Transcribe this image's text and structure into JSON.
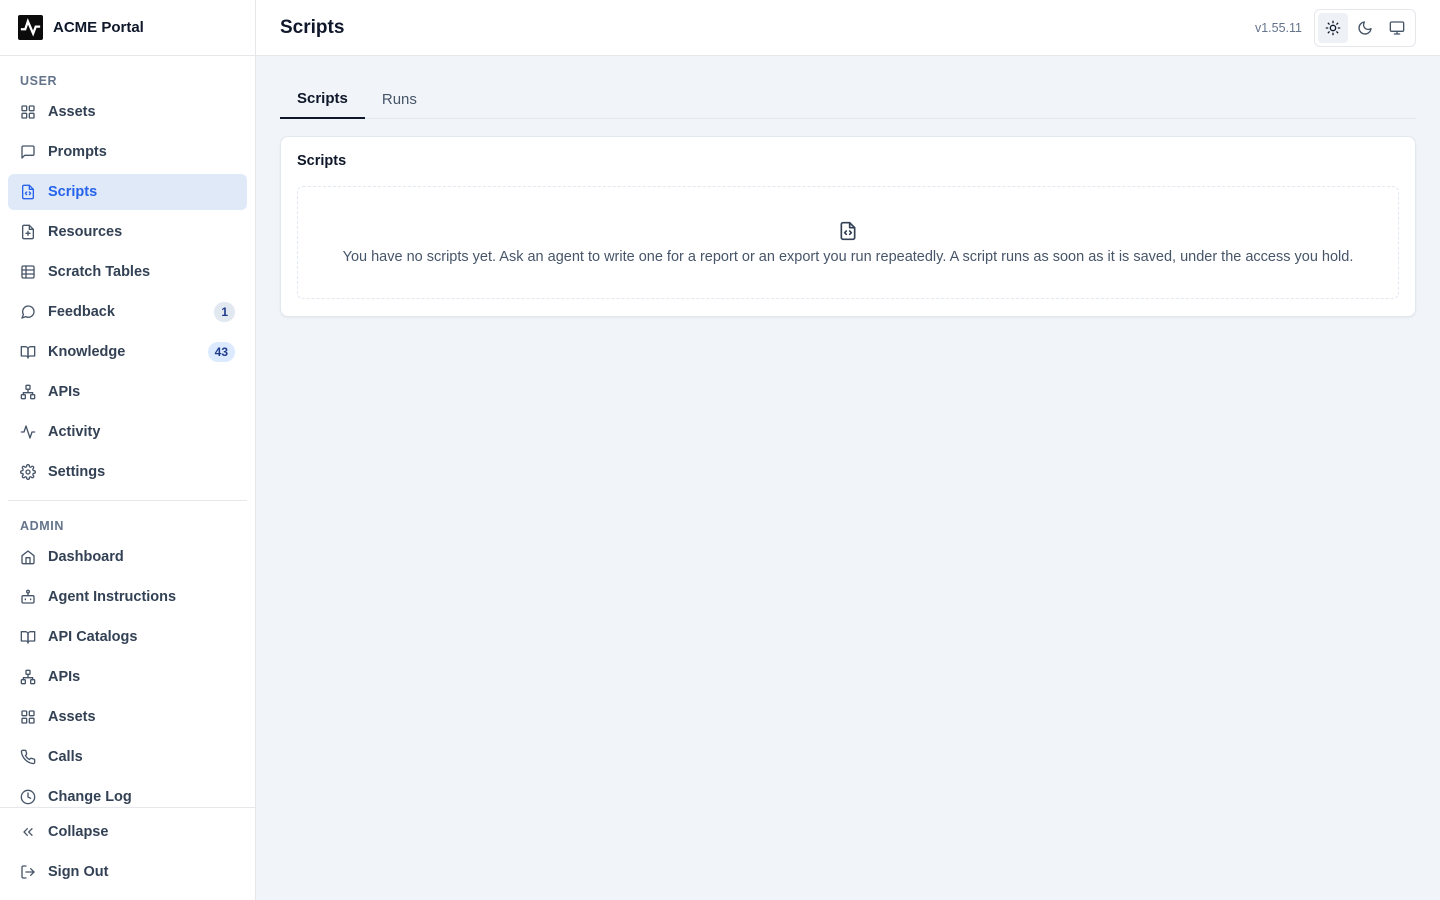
{
  "brand": {
    "name": "ACME Portal"
  },
  "sidebar": {
    "user_section_label": "USER",
    "user_items": [
      {
        "label": "Assets",
        "icon": "grid-icon"
      },
      {
        "label": "Prompts",
        "icon": "message-square-icon"
      },
      {
        "label": "Scripts",
        "icon": "file-code-icon",
        "active": true
      },
      {
        "label": "Resources",
        "icon": "file-plus-icon"
      },
      {
        "label": "Scratch Tables",
        "icon": "table-icon"
      },
      {
        "label": "Feedback",
        "icon": "message-circle-icon",
        "badge": "1"
      },
      {
        "label": "Knowledge",
        "icon": "book-open-icon",
        "badge": "43"
      },
      {
        "label": "APIs",
        "icon": "network-icon"
      },
      {
        "label": "Activity",
        "icon": "activity-icon"
      },
      {
        "label": "Settings",
        "icon": "gear-icon"
      }
    ],
    "admin_section_label": "ADMIN",
    "admin_items": [
      {
        "label": "Dashboard",
        "icon": "home-icon"
      },
      {
        "label": "Agent Instructions",
        "icon": "bot-icon"
      },
      {
        "label": "API Catalogs",
        "icon": "book-open-icon"
      },
      {
        "label": "APIs",
        "icon": "network-icon"
      },
      {
        "label": "Assets",
        "icon": "grid-icon"
      },
      {
        "label": "Calls",
        "icon": "phone-icon"
      },
      {
        "label": "Change Log",
        "icon": "clock-icon"
      }
    ],
    "footer": {
      "collapse_label": "Collapse",
      "signout_label": "Sign Out"
    }
  },
  "header": {
    "title": "Scripts",
    "version": "v1.55.11",
    "theme": {
      "active": "light"
    }
  },
  "main": {
    "tabs": [
      {
        "label": "Scripts",
        "active": true
      },
      {
        "label": "Runs",
        "active": false
      }
    ],
    "card": {
      "title": "Scripts",
      "empty_message": "You have no scripts yet. Ask an agent to write one for a report or an export you run repeatedly. A script runs as soon as it is saved, under the access you hold."
    }
  },
  "colors": {
    "accent": "#2563eb",
    "active_bg": "#e0e9f8",
    "page_bg": "#f1f5f9"
  }
}
